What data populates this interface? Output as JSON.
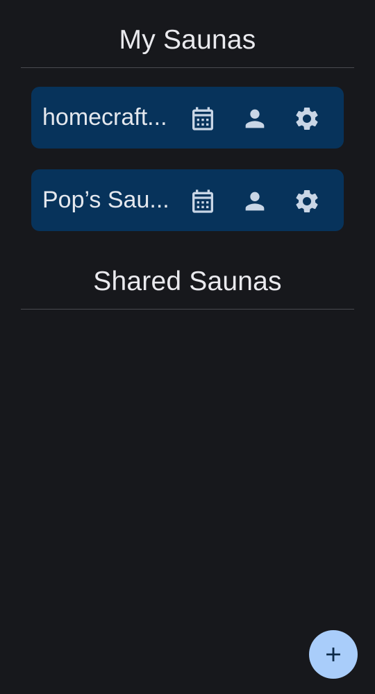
{
  "my_saunas": {
    "title": "My Saunas",
    "items": [
      {
        "name": "homecraft..."
      },
      {
        "name": "Pop’s Sau..."
      }
    ]
  },
  "shared_saunas": {
    "title": "Shared Saunas",
    "items": []
  },
  "icons": {
    "calendar": "calendar-icon",
    "user": "person-icon",
    "settings": "gear-icon",
    "add": "plus-icon"
  },
  "colors": {
    "background": "#17181c",
    "card": "#07335b",
    "icon": "#c9d6e6",
    "fab": "#a9cdfa",
    "fab_icon": "#0d2a48",
    "divider": "#4a4b50"
  }
}
